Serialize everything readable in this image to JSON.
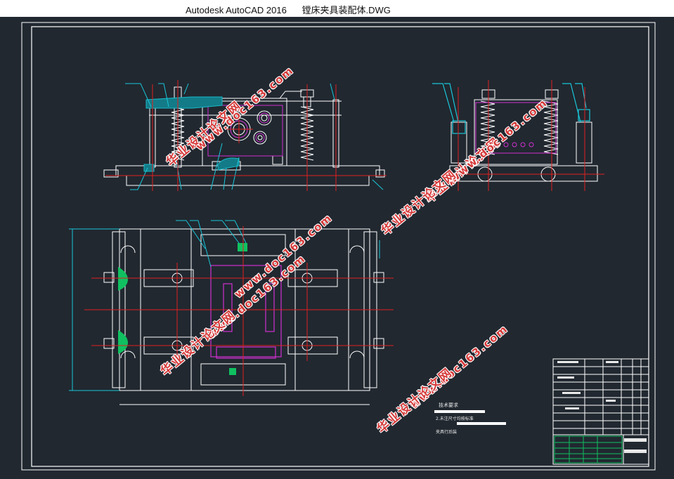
{
  "window": {
    "title": "Autodesk AutoCAD 2016      镗床夹具装配体.DWG"
  },
  "watermarks": [
    {
      "text": "华业设计论文网",
      "url": "www.doc163.com"
    }
  ],
  "notes": {
    "heading": "技术要求",
    "line2": "2.未注尺寸均按标准",
    "line3": "夹具行后装"
  },
  "colors": {
    "background": "#212830",
    "frame": "#ffffff",
    "geometry": "#ffffff",
    "centerline": "#e02020",
    "dimension": "#19c6d8",
    "highlight": "#d030d0",
    "section": "#19b8c8",
    "hatch": "#c7b830",
    "titleblock_green": "#10c060",
    "watermark": "#d63a3a"
  }
}
